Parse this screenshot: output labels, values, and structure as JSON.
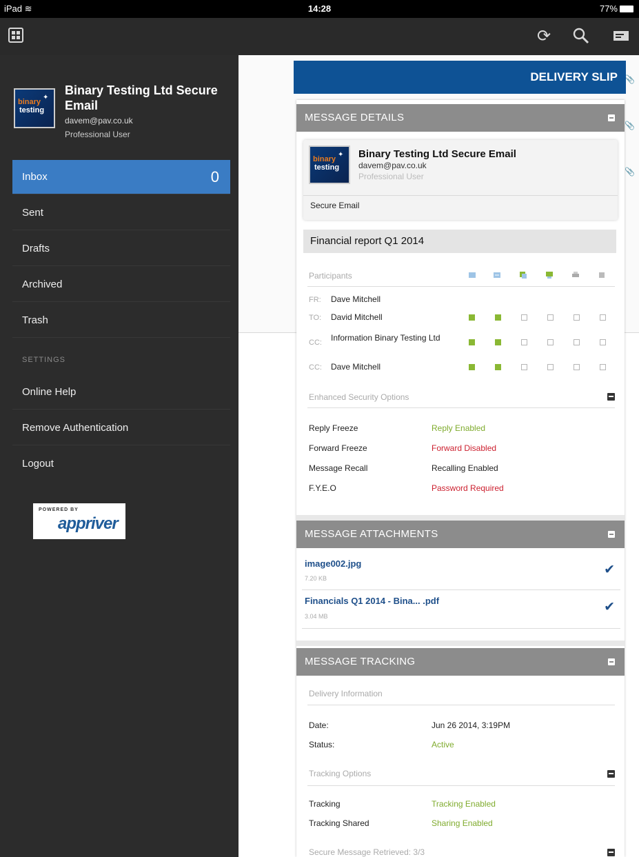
{
  "status_bar": {
    "device": "iPad",
    "time": "14:28",
    "battery": "77%"
  },
  "toolbar": {
    "icons": [
      "grid-icon",
      "refresh-icon",
      "search-icon",
      "compose-icon"
    ]
  },
  "sidebar": {
    "account_name": "Binary Testing Ltd Secure Email",
    "email": "davem@pav.co.uk",
    "role": "Professional User",
    "logo_text_1": "binary",
    "logo_text_2": "testing",
    "nav": [
      {
        "label": "Inbox",
        "count": "0"
      },
      {
        "label": "Sent"
      },
      {
        "label": "Drafts"
      },
      {
        "label": "Archived"
      },
      {
        "label": "Trash"
      }
    ],
    "settings_heading": "SETTINGS",
    "settings": [
      {
        "label": "Online Help"
      },
      {
        "label": "Remove Authentication"
      },
      {
        "label": "Logout"
      }
    ],
    "powered_by": "POWERED BY",
    "powered_brand": "appriver"
  },
  "delivery": {
    "title": "DELIVERY SLIP",
    "details": {
      "heading": "MESSAGE DETAILS",
      "sender_name": "Binary Testing Ltd Secure Email",
      "sender_email": "davem@pav.co.uk",
      "sender_role": "Professional User",
      "message_type": "Secure Email",
      "subject": "Financial report Q1 2014",
      "participants_label": "Participants",
      "participants": [
        {
          "prefix": "FR:",
          "name": "Dave Mitchell",
          "checks": []
        },
        {
          "prefix": "TO:",
          "name": "David Mitchell",
          "checks": [
            true,
            true,
            false,
            false,
            false,
            false
          ]
        },
        {
          "prefix": "CC:",
          "name": "Information Binary Testing Ltd",
          "checks": [
            true,
            true,
            false,
            false,
            false,
            false
          ]
        },
        {
          "prefix": "CC:",
          "name": "Dave Mitchell",
          "checks": [
            true,
            true,
            false,
            false,
            false,
            false
          ]
        }
      ],
      "security_label": "Enhanced Security Options",
      "security": [
        {
          "key": "Reply Freeze",
          "value": "Reply Enabled",
          "color": "#7fab2d"
        },
        {
          "key": "Forward Freeze",
          "value": "Forward Disabled",
          "color": "#cc1f2e"
        },
        {
          "key": "Message Recall",
          "value": "Recalling Enabled",
          "color": "#222222"
        },
        {
          "key": "F.Y.E.O",
          "value": "Password Required",
          "color": "#cc1f2e"
        }
      ]
    },
    "attachments": {
      "heading": "MESSAGE ATTACHMENTS",
      "items": [
        {
          "name": "image002.jpg",
          "size": "7.20 KB"
        },
        {
          "name": "Financials Q1 2014 - Bina... .pdf",
          "size": "3.04 MB"
        }
      ]
    },
    "tracking": {
      "heading": "MESSAGE TRACKING",
      "delivery_label": "Delivery Information",
      "date_label": "Date:",
      "date_value": "Jun 26 2014, 3:19PM",
      "status_label": "Status:",
      "status_value": "Active",
      "options_label": "Tracking Options",
      "tracking_label": "Tracking",
      "tracking_value": "Tracking Enabled",
      "shared_label": "Tracking Shared",
      "shared_value": "Sharing Enabled",
      "retrieved_label": "Secure Message Retrieved: 3/3"
    }
  }
}
